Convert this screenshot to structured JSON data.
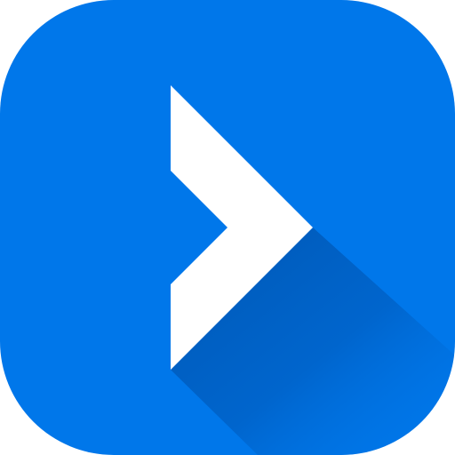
{
  "icon": {
    "name": "chevron-right-icon",
    "background_color": "#0077ea",
    "glyph_color": "#ffffff",
    "shadow_color": "#0057b3"
  }
}
